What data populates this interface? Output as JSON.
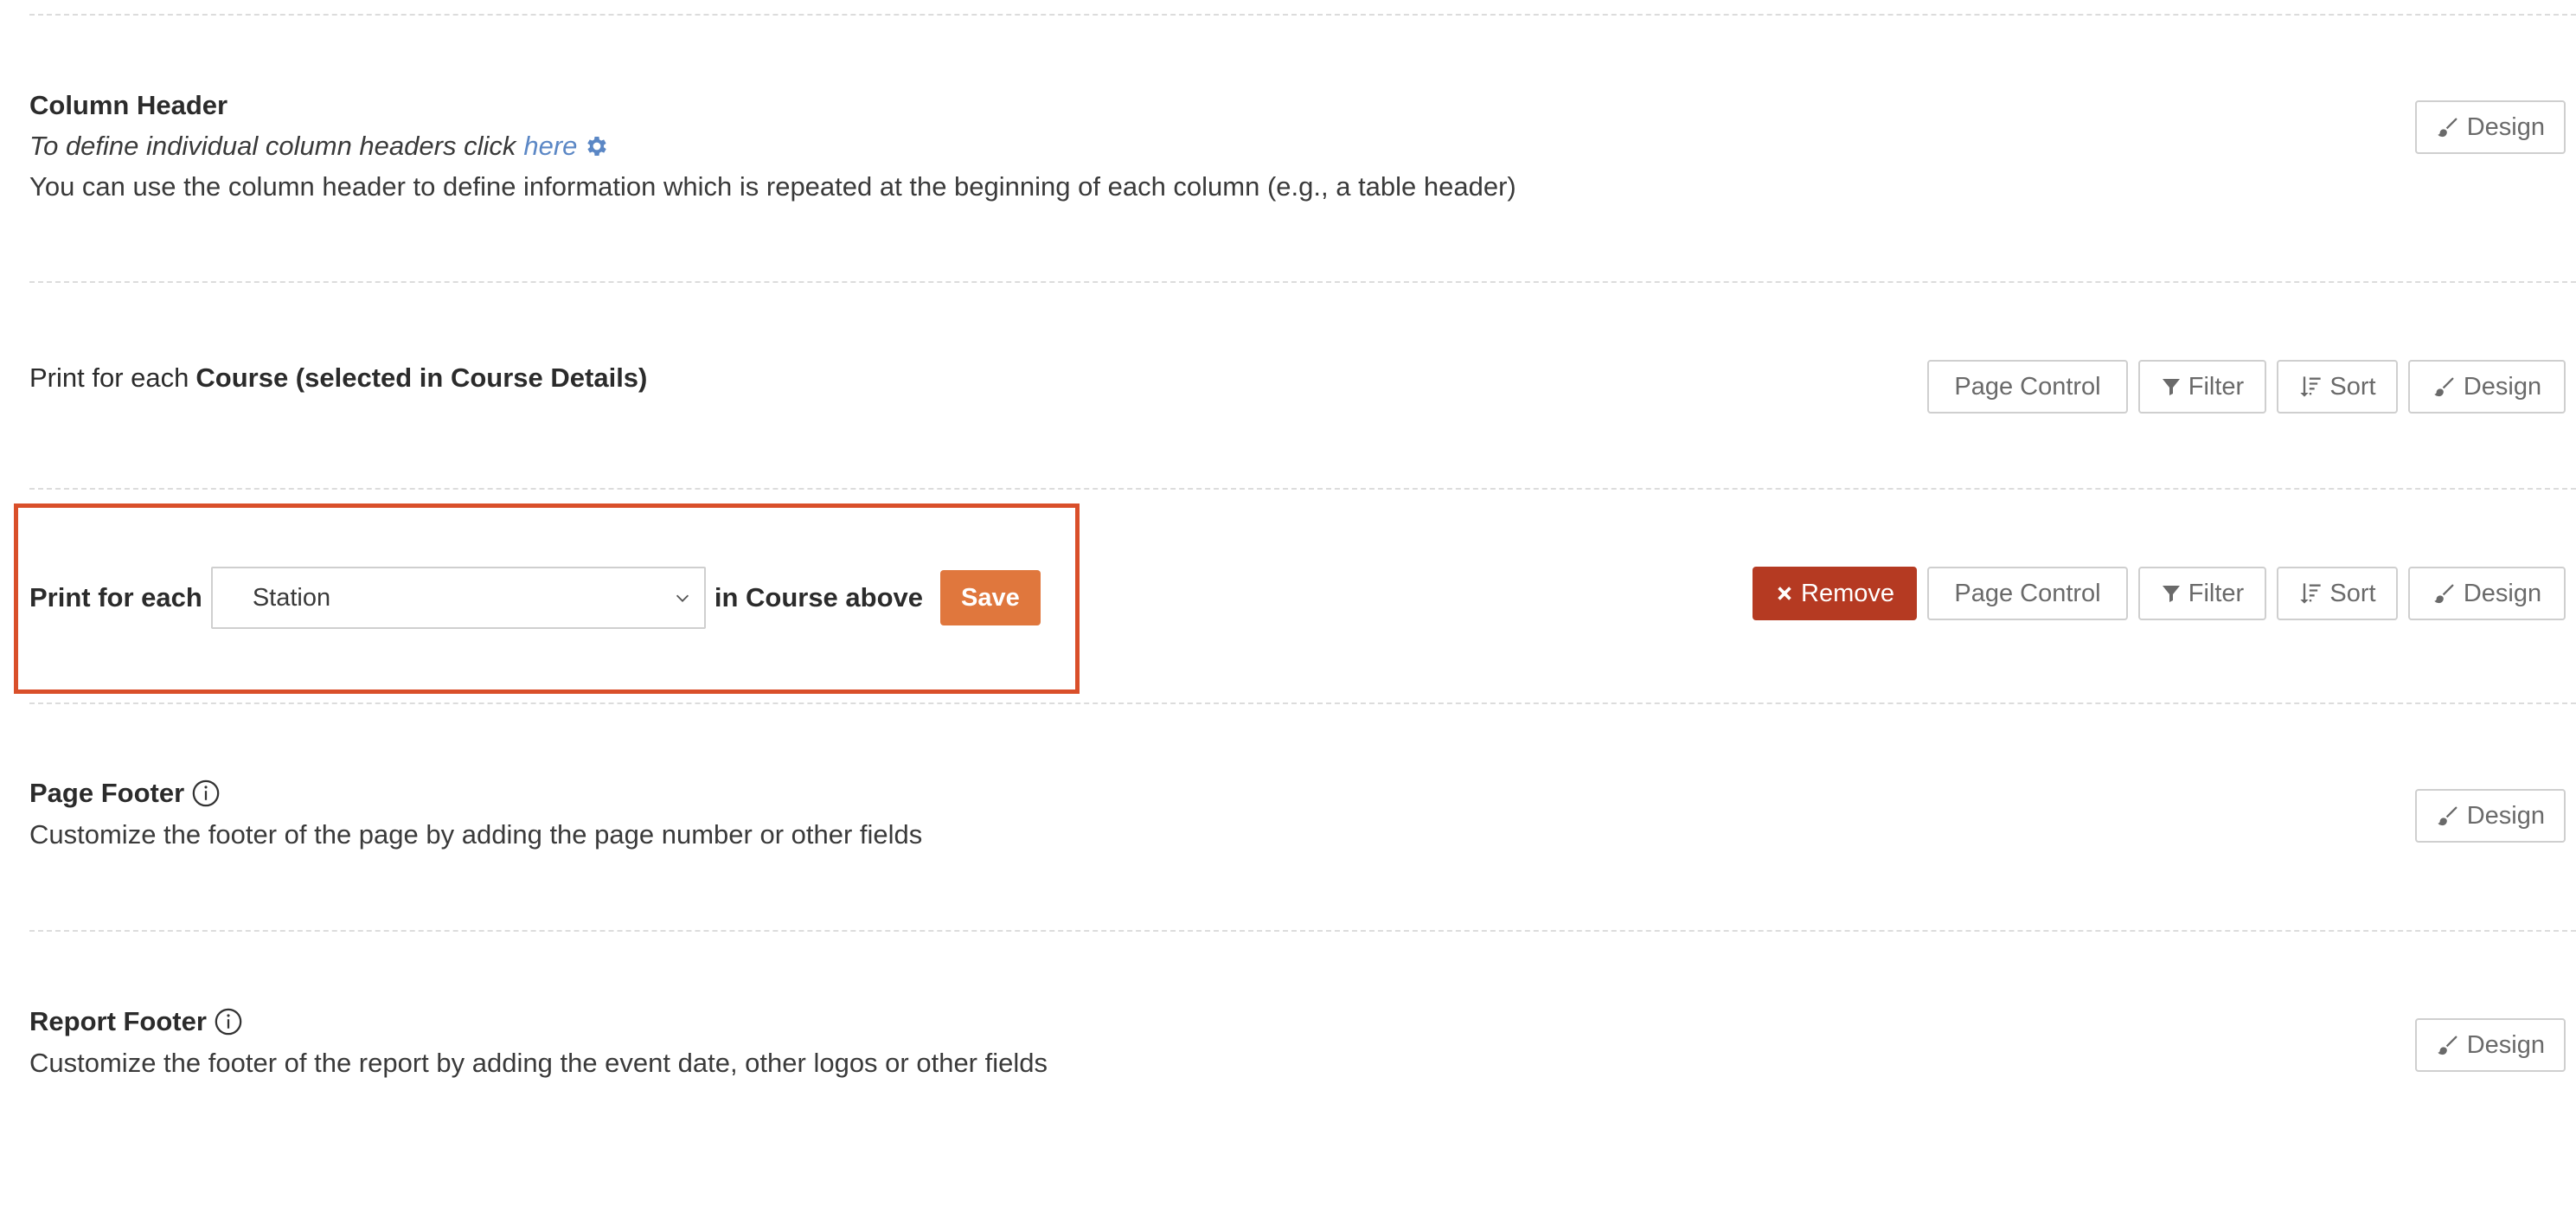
{
  "column_header": {
    "title": "Column Header",
    "italic_prefix": "To define individual column headers click",
    "link_text": "here",
    "description": "You can use the column header to define information which is repeated at the beginning of each column (e.g., a table header)",
    "design_label": "Design"
  },
  "course_section": {
    "title_prefix": "Print for each ",
    "title_bold": "Course (selected in Course Details)",
    "buttons": {
      "page_control": "Page Control",
      "filter": "Filter",
      "sort": "Sort",
      "design": "Design"
    }
  },
  "station_section": {
    "prefix": "Print for each",
    "select_value": "Station",
    "suffix": "in Course above",
    "save_label": "Save",
    "buttons": {
      "remove": "Remove",
      "page_control": "Page Control",
      "filter": "Filter",
      "sort": "Sort",
      "design": "Design"
    },
    "highlight_color": "#d94f2a"
  },
  "page_footer": {
    "title": "Page Footer",
    "description": "Customize the footer of the page by adding the page number or other fields",
    "design_label": "Design"
  },
  "report_footer": {
    "title": "Report Footer",
    "description": "Customize the footer of the report by adding the event date, other logos or other fields",
    "design_label": "Design"
  },
  "colors": {
    "accent_link": "#5b87c5",
    "save_button": "#e0773d",
    "remove_button": "#b53a22"
  }
}
